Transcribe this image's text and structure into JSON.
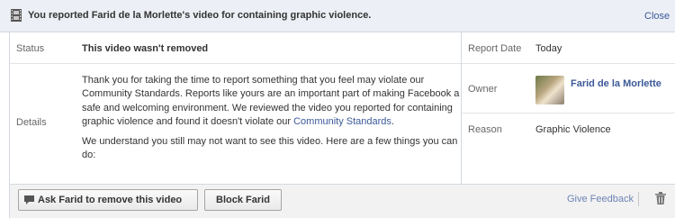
{
  "header": {
    "title": "You reported Farid de la Morlette's video for containing graphic violence.",
    "close_label": "Close",
    "icon": "film-icon"
  },
  "report": {
    "status_label": "Status",
    "status_value": "This video wasn't removed",
    "details_label": "Details",
    "details_p1_before_link": "Thank you for taking the time to report something that you feel may violate our Community Standards. Reports like yours are an important part of making Facebook a safe and welcoming environment. We reviewed the video you reported for containing graphic violence and found it doesn't violate our ",
    "details_p1_link": "Community Standards",
    "details_p1_after_link": ".",
    "details_p2": "We understand you still may not want to see this video. Here are a few things you can do:"
  },
  "side": {
    "report_date_label": "Report Date",
    "report_date_value": "Today",
    "owner_label": "Owner",
    "owner_name": "Farid de la Morlette",
    "reason_label": "Reason",
    "reason_value": "Graphic Violence"
  },
  "footer": {
    "ask_button_label": "Ask Farid to remove this video",
    "block_button_label": "Block Farid",
    "give_feedback_label": "Give Feedback"
  },
  "colors": {
    "link": "#3b5998",
    "header_bg": "#eceff5",
    "footer_bg": "#f2f2f2"
  }
}
